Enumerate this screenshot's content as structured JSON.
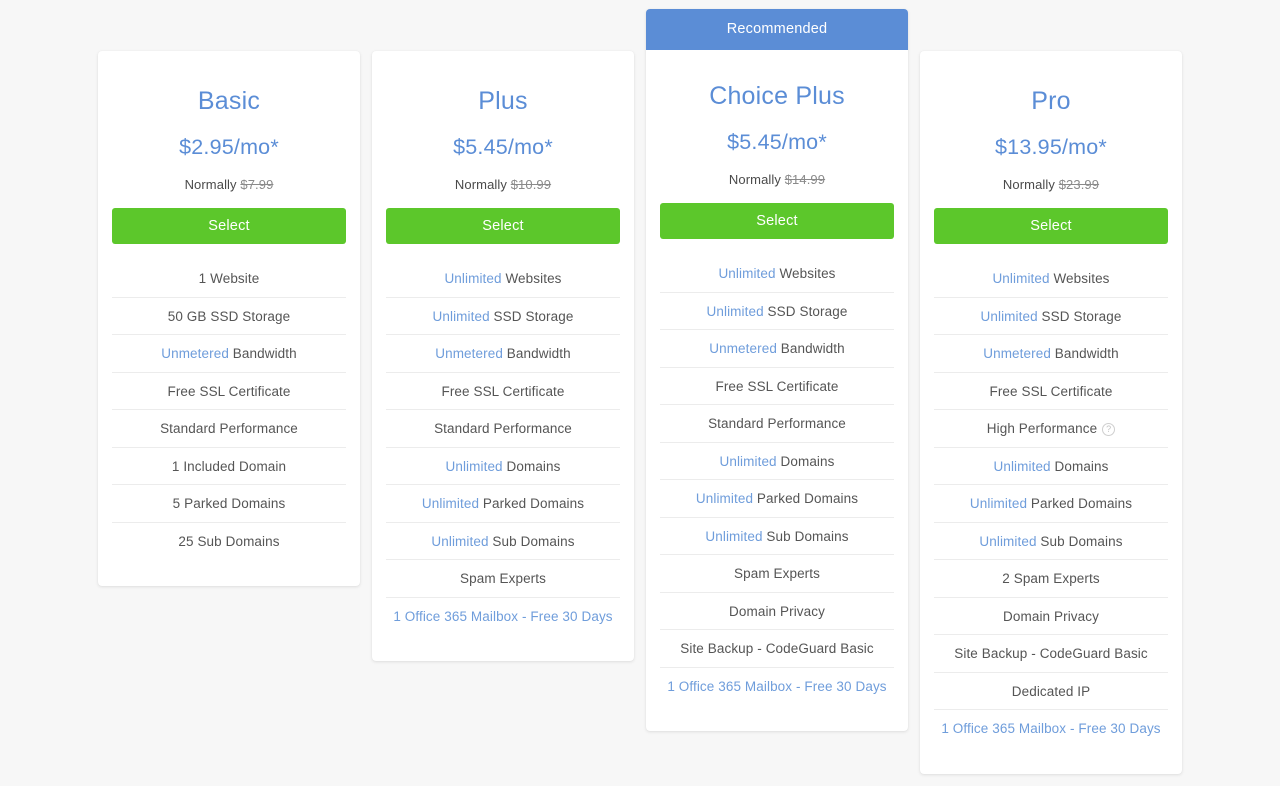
{
  "page": {
    "background_color": "#f7f7f7",
    "accent_blue": "#5b8dd6",
    "highlight_blue": "#6f9ddb",
    "button_green": "#5cc72b"
  },
  "plans": [
    {
      "name": "Basic",
      "price": "$2.95/mo*",
      "normally_label": "Normally",
      "normally_price": "$7.99",
      "select_label": "Select",
      "recommended": false,
      "features": [
        {
          "lead": "",
          "rest": "1 Website",
          "link": false
        },
        {
          "lead": "",
          "rest": "50 GB SSD Storage",
          "link": false
        },
        {
          "lead": "Unmetered",
          "rest": " Bandwidth",
          "link": false
        },
        {
          "lead": "",
          "rest": "Free SSL Certificate",
          "link": false
        },
        {
          "lead": "",
          "rest": "Standard Performance",
          "link": false
        },
        {
          "lead": "",
          "rest": "1 Included Domain",
          "link": false
        },
        {
          "lead": "",
          "rest": "5 Parked Domains",
          "link": false
        },
        {
          "lead": "",
          "rest": "25 Sub Domains",
          "link": false
        }
      ]
    },
    {
      "name": "Plus",
      "price": "$5.45/mo*",
      "normally_label": "Normally",
      "normally_price": "$10.99",
      "select_label": "Select",
      "recommended": false,
      "features": [
        {
          "lead": "Unlimited",
          "rest": " Websites",
          "link": false
        },
        {
          "lead": "Unlimited",
          "rest": " SSD Storage",
          "link": false
        },
        {
          "lead": "Unmetered",
          "rest": " Bandwidth",
          "link": false
        },
        {
          "lead": "",
          "rest": "Free SSL Certificate",
          "link": false
        },
        {
          "lead": "",
          "rest": "Standard Performance",
          "link": false
        },
        {
          "lead": "Unlimited",
          "rest": " Domains",
          "link": false
        },
        {
          "lead": "Unlimited",
          "rest": " Parked Domains",
          "link": false
        },
        {
          "lead": "Unlimited",
          "rest": " Sub Domains",
          "link": false
        },
        {
          "lead": "",
          "rest": "Spam Experts",
          "link": false
        },
        {
          "lead": "",
          "rest": "1 Office 365 Mailbox - Free 30 Days",
          "link": true
        }
      ]
    },
    {
      "name": "Choice Plus",
      "price": "$5.45/mo*",
      "normally_label": "Normally",
      "normally_price": "$14.99",
      "select_label": "Select",
      "recommended": true,
      "recommended_label": "Recommended",
      "features": [
        {
          "lead": "Unlimited",
          "rest": " Websites",
          "link": false
        },
        {
          "lead": "Unlimited",
          "rest": " SSD Storage",
          "link": false
        },
        {
          "lead": "Unmetered",
          "rest": " Bandwidth",
          "link": false
        },
        {
          "lead": "",
          "rest": "Free SSL Certificate",
          "link": false
        },
        {
          "lead": "",
          "rest": "Standard Performance",
          "link": false
        },
        {
          "lead": "Unlimited",
          "rest": " Domains",
          "link": false
        },
        {
          "lead": "Unlimited",
          "rest": " Parked Domains",
          "link": false
        },
        {
          "lead": "Unlimited",
          "rest": " Sub Domains",
          "link": false
        },
        {
          "lead": "",
          "rest": "Spam Experts",
          "link": false
        },
        {
          "lead": "",
          "rest": "Domain Privacy",
          "link": false
        },
        {
          "lead": "",
          "rest": "Site Backup - CodeGuard Basic",
          "link": false
        },
        {
          "lead": "",
          "rest": "1 Office 365 Mailbox - Free 30 Days",
          "link": true
        }
      ]
    },
    {
      "name": "Pro",
      "price": "$13.95/mo*",
      "normally_label": "Normally",
      "normally_price": "$23.99",
      "select_label": "Select",
      "recommended": false,
      "features": [
        {
          "lead": "Unlimited",
          "rest": " Websites",
          "link": false
        },
        {
          "lead": "Unlimited",
          "rest": " SSD Storage",
          "link": false
        },
        {
          "lead": "Unmetered",
          "rest": " Bandwidth",
          "link": false
        },
        {
          "lead": "",
          "rest": "Free SSL Certificate",
          "link": false
        },
        {
          "lead": "",
          "rest": "High Performance",
          "link": false,
          "info_icon": "?"
        },
        {
          "lead": "Unlimited",
          "rest": " Domains",
          "link": false
        },
        {
          "lead": "Unlimited",
          "rest": " Parked Domains",
          "link": false
        },
        {
          "lead": "Unlimited",
          "rest": " Sub Domains",
          "link": false
        },
        {
          "lead": "",
          "rest": "2 Spam Experts",
          "link": false
        },
        {
          "lead": "",
          "rest": "Domain Privacy",
          "link": false
        },
        {
          "lead": "",
          "rest": "Site Backup - CodeGuard Basic",
          "link": false
        },
        {
          "lead": "",
          "rest": "Dedicated IP",
          "link": false
        },
        {
          "lead": "",
          "rest": "1 Office 365 Mailbox - Free 30 Days",
          "link": true
        }
      ]
    }
  ]
}
